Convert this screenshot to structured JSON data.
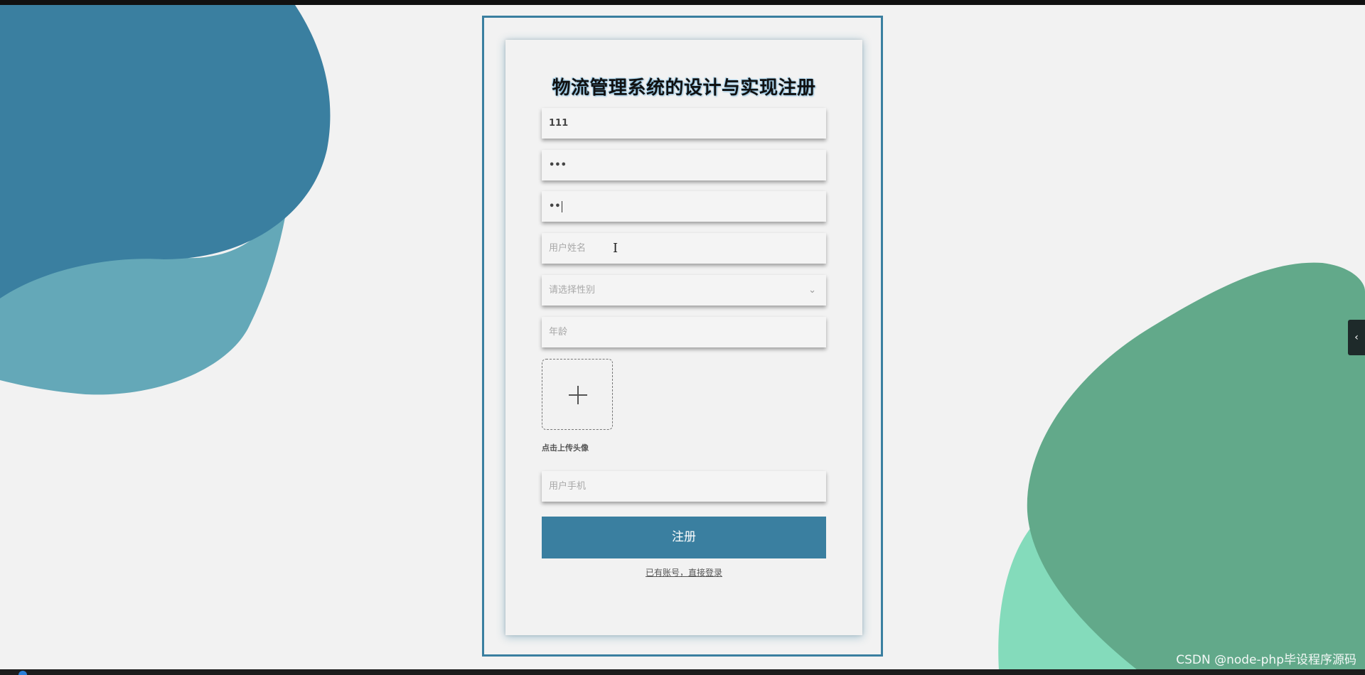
{
  "page": {
    "title": "物流管理系统的设计与实现注册"
  },
  "form": {
    "fields": [
      {
        "name": "username",
        "value": "111",
        "placeholder": ""
      },
      {
        "name": "password",
        "value": "•••",
        "placeholder": ""
      },
      {
        "name": "confirm-password",
        "value": "••",
        "placeholder": ""
      },
      {
        "name": "full-name",
        "value": "",
        "placeholder": "用户姓名"
      },
      {
        "name": "gender",
        "value": "",
        "placeholder": "请选择性别"
      },
      {
        "name": "age",
        "value": "",
        "placeholder": "年龄"
      },
      {
        "name": "phone",
        "value": "",
        "placeholder": "用户手机"
      }
    ],
    "upload_label": "点击上传头像",
    "submit_label": "注册",
    "login_link": "已有账号，直接登录"
  },
  "side_tab": {
    "icon": "chevron-left-icon",
    "glyph": "‹"
  },
  "watermark": "CSDN @node-php毕设程序源码",
  "colors": {
    "accent": "#3a7fa0",
    "blob_dark_blue": "#3a7fa0",
    "blob_light_blue": "#64a8b8",
    "blob_green": "#62a98a",
    "blob_mint": "#84dbbb"
  }
}
